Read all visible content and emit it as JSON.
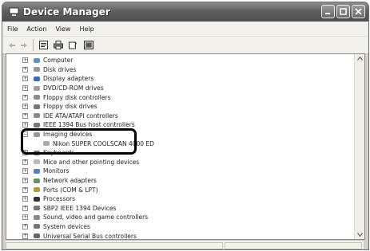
{
  "window": {
    "title": "Device Manager",
    "icon": "device-manager-icon"
  },
  "menu": [
    "File",
    "Action",
    "View",
    "Help"
  ],
  "toolbar": [
    {
      "name": "back-button",
      "icon": "back-arrow-icon"
    },
    {
      "name": "forward-button",
      "icon": "forward-arrow-icon"
    },
    {
      "name": "properties-button",
      "icon": "properties-icon"
    },
    {
      "name": "print-button",
      "icon": "printer-icon"
    },
    {
      "name": "help-button",
      "icon": "help-icon"
    },
    {
      "name": "scan-hardware-button",
      "icon": "scan-hardware-icon"
    }
  ],
  "tree": {
    "nodes": [
      {
        "label": "Computer",
        "icon": "computer-icon",
        "expanded": false
      },
      {
        "label": "Disk drives",
        "icon": "disk-drive-icon",
        "expanded": false
      },
      {
        "label": "Display adapters",
        "icon": "display-adapter-icon",
        "expanded": false
      },
      {
        "label": "DVD/CD-ROM drives",
        "icon": "dvd-drive-icon",
        "expanded": false
      },
      {
        "label": "Floppy disk controllers",
        "icon": "floppy-controller-icon",
        "expanded": false
      },
      {
        "label": "Floppy disk drives",
        "icon": "floppy-drive-icon",
        "expanded": false
      },
      {
        "label": "IDE ATA/ATAPI controllers",
        "icon": "ide-controller-icon",
        "expanded": false
      },
      {
        "label": "IEEE 1394 Bus host controllers",
        "icon": "ieee1394-icon",
        "expanded": false
      },
      {
        "label": "Imaging devices",
        "icon": "imaging-device-icon",
        "expanded": true,
        "children": [
          {
            "label": "Nikon SUPER COOLSCAN 4000 ED",
            "icon": "scanner-icon"
          }
        ]
      },
      {
        "label": "Keyboards",
        "icon": "keyboard-icon",
        "expanded": false
      },
      {
        "label": "Mice and other pointing devices",
        "icon": "mouse-icon",
        "expanded": false
      },
      {
        "label": "Monitors",
        "icon": "monitor-icon",
        "expanded": false
      },
      {
        "label": "Network adapters",
        "icon": "network-adapter-icon",
        "expanded": false
      },
      {
        "label": "Ports (COM & LPT)",
        "icon": "port-icon",
        "expanded": false
      },
      {
        "label": "Processors",
        "icon": "processor-icon",
        "expanded": false
      },
      {
        "label": "SBP2 IEEE 1394 Devices",
        "icon": "sbp2-device-icon",
        "expanded": false
      },
      {
        "label": "Sound, video and game controllers",
        "icon": "sound-icon",
        "expanded": false
      },
      {
        "label": "System devices",
        "icon": "system-devices-icon",
        "expanded": false
      },
      {
        "label": "Universal Serial Bus controllers",
        "icon": "usb-icon",
        "expanded": false
      }
    ]
  },
  "colors": {
    "titlebar": "#5f5f5f",
    "highlight_border": "#000000"
  }
}
